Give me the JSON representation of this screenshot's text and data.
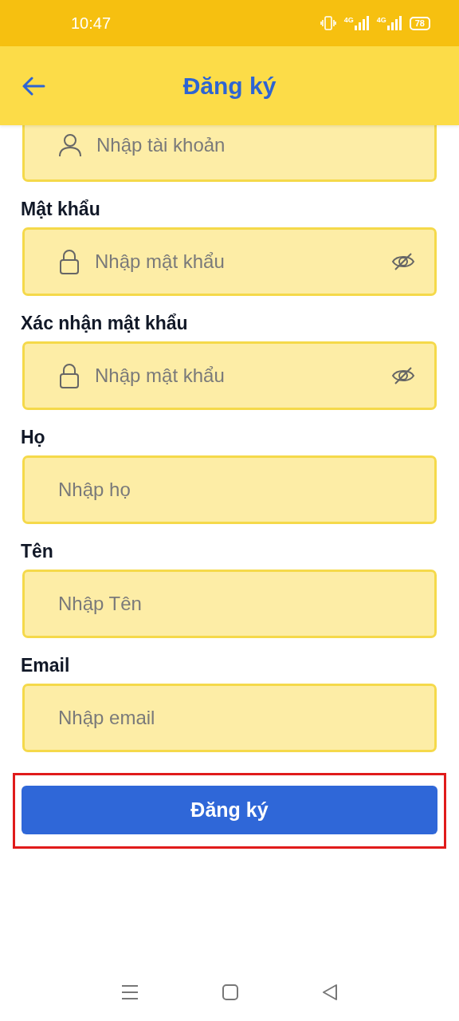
{
  "status_bar": {
    "time": "10:47",
    "networks": [
      {
        "label": "4G"
      },
      {
        "label": "4G"
      }
    ],
    "battery": "78"
  },
  "header": {
    "title": "Đăng ký"
  },
  "fields": [
    {
      "kind": "account",
      "placeholder": "Nhập tài khoản"
    },
    {
      "kind": "password",
      "label": "Mật khẩu",
      "placeholder": "Nhập mật khẩu"
    },
    {
      "kind": "password",
      "label": "Xác nhận mật khẩu",
      "placeholder": "Nhập mật khẩu"
    },
    {
      "kind": "text",
      "label": "Họ",
      "placeholder": "Nhập họ"
    },
    {
      "kind": "text",
      "label": "Tên",
      "placeholder": "Nhập Tên"
    },
    {
      "kind": "text",
      "label": "Email",
      "placeholder": "Nhập email"
    }
  ],
  "submit": {
    "label": "Đăng ký",
    "highlighted": true
  }
}
